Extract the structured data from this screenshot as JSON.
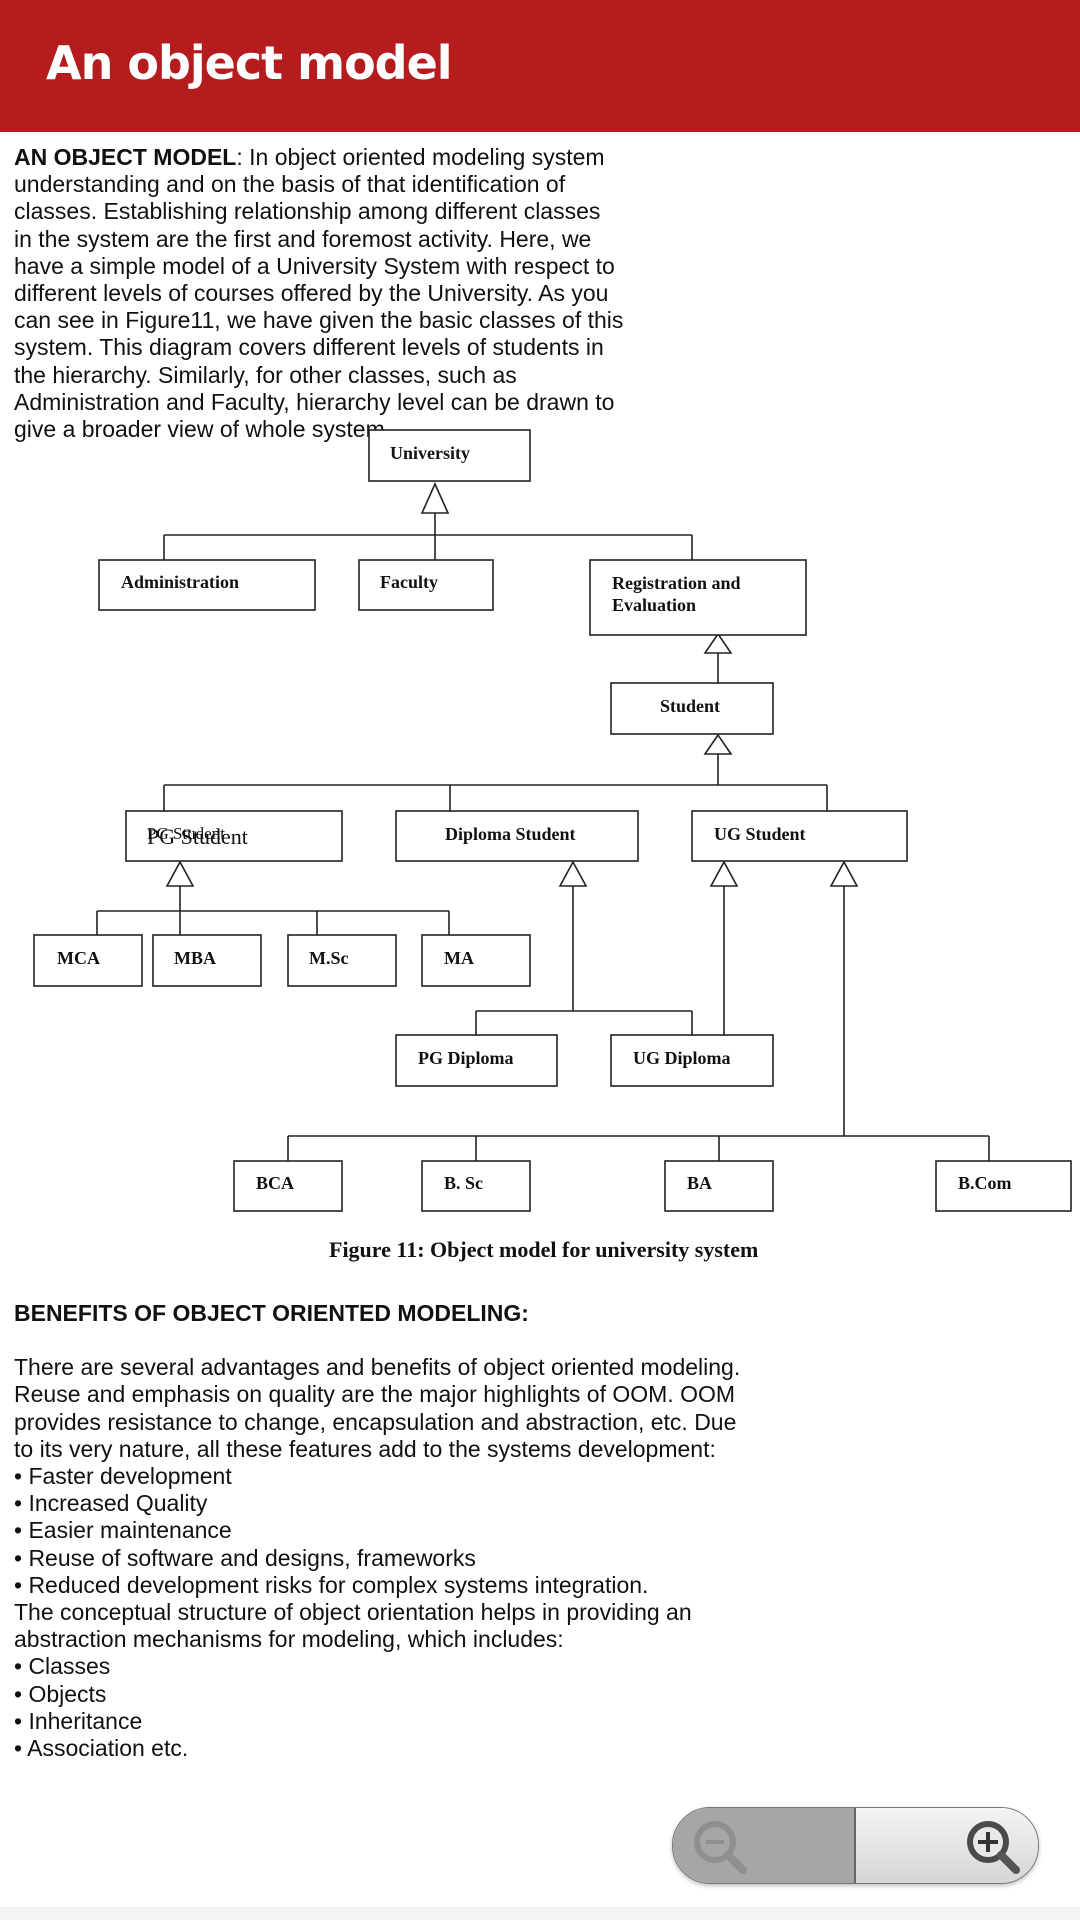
{
  "header": {
    "title": "An object model",
    "color": "#b41c1e"
  },
  "intro": {
    "label": "AN OBJECT MODEL",
    "text": ": In object oriented modeling system understanding and on the basis of that identification of classes. Establishing relationship among different classes in the system are the first and foremost activity. Here, we have a simple model of a University System with respect to different levels of courses offered by the University. As you can see in Figure11, we have given the basic classes of this system. This diagram covers different levels of students in the hierarchy. Similarly, for other classes, such as Administration and Faculty, hierarchy level can be drawn to give a broader view of whole system."
  },
  "diagram": {
    "nodes": {
      "university": "University",
      "administration": "Administration",
      "faculty": "Faculty",
      "registration_line1": "Registration and",
      "registration_line2": "Evaluation",
      "student": "Student",
      "pg_student": "PG Student",
      "diploma_student": "Diploma Student",
      "ug_student": "UG Student",
      "mca": "MCA",
      "mba": "MBA",
      "msc": "M.Sc",
      "ma": "MA",
      "pg_diploma": "PG Diploma",
      "ug_diploma": "UG Diploma",
      "bca": "BCA",
      "bsc": "B. Sc",
      "ba": "BA",
      "bcom": "B.Com"
    },
    "caption": "Figure 11: Object model for university system"
  },
  "benefits": {
    "heading": "BENEFITS OF OBJECT ORIENTED MODELING:",
    "paragraph": "There are several advantages and benefits of object oriented modeling. Reuse and emphasis on quality are the major highlights of OOM. OOM provides resistance to change, encapsulation and abstraction, etc. Due to its very nature, all these features add to the systems development:",
    "list1": [
      "• Faster development",
      "• Increased Quality",
      "• Easier maintenance",
      "• Reuse of software and designs, frameworks",
      "• Reduced development risks for complex systems integration."
    ],
    "paragraph2": "The conceptual structure of object orientation helps in providing an abstraction mechanisms for modeling, which includes:",
    "list2": [
      "• Classes",
      "• Objects",
      "• Inheritance",
      "• Association etc."
    ]
  },
  "zoom_controls": {
    "zoom_out": "zoom-out-icon",
    "zoom_in": "zoom-in-icon"
  }
}
